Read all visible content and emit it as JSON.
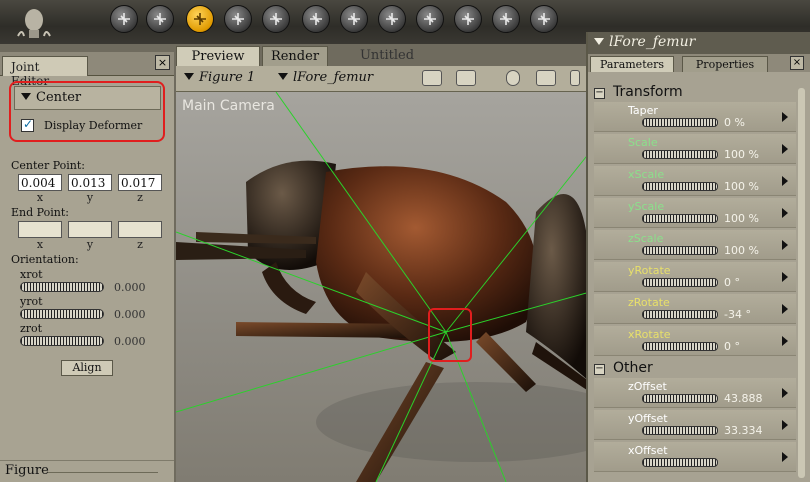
{
  "toolbar": {
    "tools": [
      {
        "icon": "rotate-icon"
      },
      {
        "icon": "twist-icon"
      },
      {
        "icon": "translate-icon",
        "active": true
      },
      {
        "icon": "translate-in-out-icon"
      },
      {
        "icon": "scale-icon"
      },
      {
        "icon": "taper-icon"
      },
      {
        "icon": "chain-break-icon"
      },
      {
        "icon": "color-icon"
      },
      {
        "icon": "grouping-icon"
      },
      {
        "icon": "view-magnifier-icon"
      },
      {
        "icon": "morphing-tool-icon"
      },
      {
        "icon": "direct-manipulation-icon"
      }
    ]
  },
  "joint_editor": {
    "tab": "Joint Editor",
    "close": "×",
    "section": "Center",
    "display_deformer": "Display Deformer",
    "center_point_label": "Center Point:",
    "center_point": {
      "x": "0.004",
      "y": "0.013",
      "z": "0.017"
    },
    "end_point_label": "End Point:",
    "axes": {
      "x": "x",
      "y": "y",
      "z": "z"
    },
    "orientation_label": "Orientation:",
    "rotations": [
      {
        "label": "xrot",
        "value": "0.000"
      },
      {
        "label": "yrot",
        "value": "0.000"
      },
      {
        "label": "zrot",
        "value": "0.000"
      }
    ],
    "align": "Align",
    "figure_section": "Figure"
  },
  "document": {
    "tabs": {
      "preview": "Preview",
      "render": "Render",
      "untitled": "Untitled"
    },
    "figure_menu": "Figure 1",
    "actor_menu": "lFore_femur",
    "camera_label": "Main Camera"
  },
  "parameters": {
    "title": "lFore_femur",
    "tabs": {
      "parameters": "Parameters",
      "properties": "Properties"
    },
    "close": "×",
    "groups": [
      {
        "name": "Transform",
        "rows": [
          {
            "name": "Taper",
            "value": "0 %",
            "color": "#ffffff"
          },
          {
            "name": "Scale",
            "value": "100 %",
            "color": "#8be08b"
          },
          {
            "name": "xScale",
            "value": "100 %",
            "color": "#8be08b"
          },
          {
            "name": "yScale",
            "value": "100 %",
            "color": "#8be08b"
          },
          {
            "name": "zScale",
            "value": "100 %",
            "color": "#8be08b"
          },
          {
            "name": "yRotate",
            "value": "0 °",
            "color": "#e8e06a"
          },
          {
            "name": "zRotate",
            "value": "-34 °",
            "color": "#e8e06a"
          },
          {
            "name": "xRotate",
            "value": "0 °",
            "color": "#e8e06a"
          }
        ]
      },
      {
        "name": "Other",
        "rows": [
          {
            "name": "zOffset",
            "value": "43.888",
            "color": "#ffffff"
          },
          {
            "name": "yOffset",
            "value": "33.334",
            "color": "#ffffff"
          },
          {
            "name": "xOffset",
            "value": "",
            "color": "#ffffff"
          }
        ]
      }
    ]
  }
}
